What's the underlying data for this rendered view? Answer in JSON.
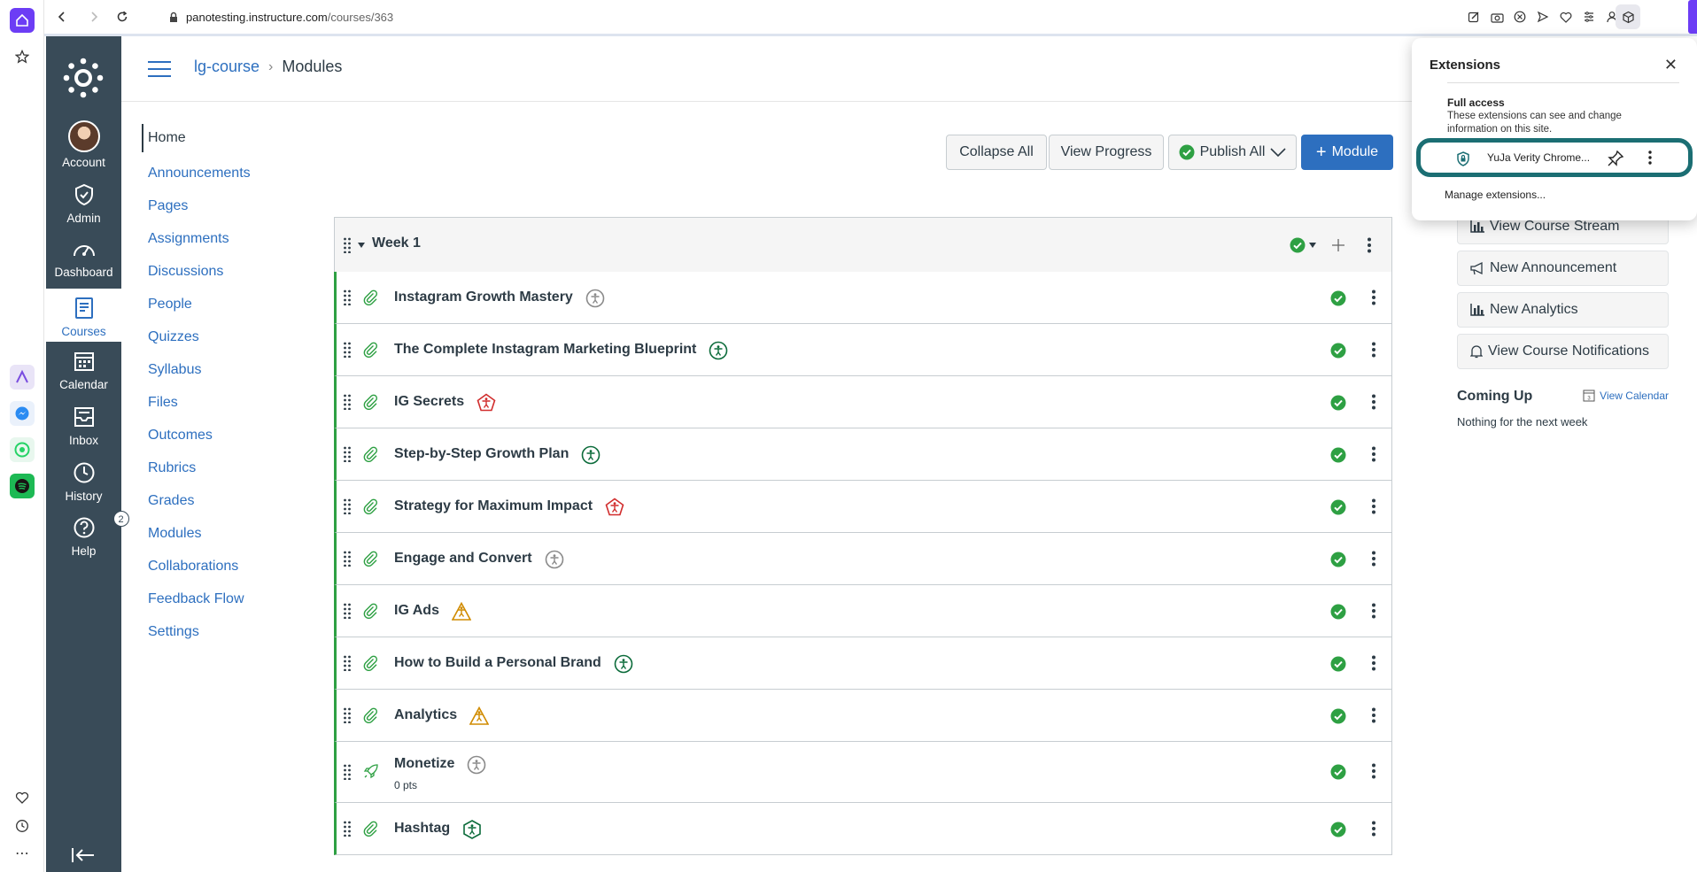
{
  "browser": {
    "url_host": "panotesting.instructure.com",
    "url_path": "/courses/363"
  },
  "global_nav": {
    "items": [
      {
        "label": "Account",
        "icon": "avatar"
      },
      {
        "label": "Admin",
        "icon": "shield-icon"
      },
      {
        "label": "Dashboard",
        "icon": "gauge-icon"
      },
      {
        "label": "Courses",
        "icon": "book-icon",
        "active": true
      },
      {
        "label": "Calendar",
        "icon": "calendar-icon"
      },
      {
        "label": "Inbox",
        "icon": "inbox-icon"
      },
      {
        "label": "History",
        "icon": "clock-icon"
      },
      {
        "label": "Help",
        "icon": "question-icon",
        "badge": "2"
      }
    ]
  },
  "header": {
    "course": "lg-course",
    "page": "Modules"
  },
  "course_nav": [
    "Home",
    "Announcements",
    "Pages",
    "Assignments",
    "Discussions",
    "People",
    "Quizzes",
    "Syllabus",
    "Files",
    "Outcomes",
    "Rubrics",
    "Grades",
    "Modules",
    "Collaborations",
    "Feedback Flow",
    "Settings"
  ],
  "toolbar": {
    "collapse_all": "Collapse All",
    "view_progress": "View Progress",
    "publish_all": "Publish All",
    "module": "Module"
  },
  "module": {
    "title": "Week 1",
    "items": [
      {
        "name": "Instagram Growth Mastery",
        "type": "attachment",
        "accessibility": "gray"
      },
      {
        "name": "The Complete Instagram Marketing Blueprint",
        "type": "attachment",
        "accessibility": "green"
      },
      {
        "name": "IG Secrets",
        "type": "attachment",
        "accessibility": "red"
      },
      {
        "name": "Step-by-Step Growth Plan",
        "type": "attachment",
        "accessibility": "green"
      },
      {
        "name": "Strategy for Maximum Impact",
        "type": "attachment",
        "accessibility": "red"
      },
      {
        "name": "Engage and Convert",
        "type": "attachment",
        "accessibility": "gray"
      },
      {
        "name": "IG Ads",
        "type": "attachment",
        "accessibility": "yellow"
      },
      {
        "name": "How to Build a Personal Brand",
        "type": "attachment",
        "accessibility": "green"
      },
      {
        "name": "Analytics",
        "type": "attachment",
        "accessibility": "yellow"
      },
      {
        "name": "Monetize",
        "type": "quiz",
        "accessibility": "gray",
        "sub": "0 pts"
      },
      {
        "name": "Hashtag",
        "type": "attachment",
        "accessibility": "green"
      }
    ]
  },
  "sidebar": {
    "buttons": [
      "View Course Stream",
      "New Announcement",
      "New Analytics",
      "View Course Notifications"
    ],
    "coming_up": "Coming Up",
    "view_calendar": "View Calendar",
    "nothing": "Nothing for the next week"
  },
  "extensions_popup": {
    "title": "Extensions",
    "full_access": "Full access",
    "description": "These extensions can see and change information on this site.",
    "extension_name": "YuJa Verity Chrome...",
    "manage": "Manage extensions..."
  },
  "colors": {
    "canvas_nav": "#394b58",
    "link": "#2d6fbf",
    "published": "#2ea043",
    "highlight_ring": "#1b6e73"
  }
}
